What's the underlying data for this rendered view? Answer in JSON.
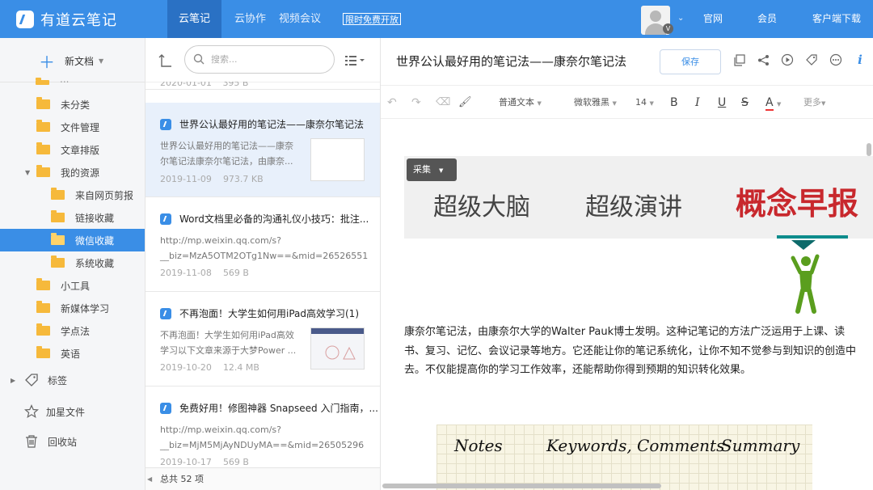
{
  "app": {
    "name": "有道云笔记"
  },
  "topnav": {
    "tabs": [
      "云笔记",
      "云协作",
      "视频会议"
    ],
    "promo": "限时免费开放",
    "links": [
      "官网",
      "会员",
      "客户端下载"
    ],
    "user_badge": "V"
  },
  "sidebar": {
    "new_doc": "新文档",
    "partial_top": "...",
    "items": [
      {
        "label": "未分类",
        "level": 1
      },
      {
        "label": "文件管理",
        "level": 1
      },
      {
        "label": "文章排版",
        "level": 1
      },
      {
        "label": "我的资源",
        "level": 1,
        "expanded": true
      },
      {
        "label": "来自网页剪报",
        "level": 2
      },
      {
        "label": "链接收藏",
        "level": 2
      },
      {
        "label": "微信收藏",
        "level": 2,
        "selected": true
      },
      {
        "label": "系统收藏",
        "level": 2
      },
      {
        "label": "小工具",
        "level": 1
      },
      {
        "label": "新媒体学习",
        "level": 1
      },
      {
        "label": "学点法",
        "level": 1
      },
      {
        "label": "英语",
        "level": 1
      }
    ],
    "tags": "标签",
    "starred": "加星文件",
    "trash": "回收站"
  },
  "notelist": {
    "search_placeholder": "搜索...",
    "partial_meta": {
      "date": "2020-01-01",
      "size": "395 B"
    },
    "cards": [
      {
        "title": "世界公认最好用的笔记法——康奈尔笔记法",
        "snippet1": "世界公认最好用的笔记法——康奈",
        "snippet2": "尔笔记法康奈尔笔记法，由康奈...",
        "date": "2019-11-09",
        "size": "973.7 KB"
      },
      {
        "title": "Word文档里必备的沟通礼仪小技巧：批注...",
        "snippet1": "http://mp.weixin.qq.com/s?",
        "snippet2": "__biz=MzA5OTM2OTg1Nw==&mid=26526551",
        "date": "2019-11-08",
        "size": "569 B"
      },
      {
        "title": "不再泡面！大学生如何用iPad高效学习(1)",
        "snippet1": "不再泡面！大学生如何用iPad高效",
        "snippet2": "学习以下文章来源于大梦Power ...",
        "date": "2019-10-20",
        "size": "12.4 MB"
      },
      {
        "title": "免费好用！修图神器 Snapseed 入门指南，...",
        "snippet1": "http://mp.weixin.qq.com/s?",
        "snippet2": "__biz=MjM5MjAyNDUyMA==&mid=26505296",
        "date": "2019-10-17",
        "size": "569 B"
      }
    ],
    "total": "总共 52 项"
  },
  "editor": {
    "title": "世界公认最好用的笔记法——康奈尔笔记法",
    "save": "保存",
    "format": {
      "style": "普通文本",
      "font": "微软雅黑",
      "size": "14",
      "more": "更多"
    },
    "banner": {
      "t1": "超级大脑",
      "t2": "超级演讲",
      "t3": "概念早报"
    },
    "caiji": "采集",
    "body": "康奈尔笔记法，由康奈尔大学的Walter Pauk博士发明。这种记笔记的方法广泛运用于上课、读书、复习、记忆、会议记录等地方。它还能让你的笔记系统化，让你不知不觉参与到知识的创造中去。不仅能提高你的学习工作效率，还能帮助你得到预期的知识转化效果。",
    "image_words": [
      "Notes",
      "Keywords, Comments",
      "Summary"
    ]
  }
}
